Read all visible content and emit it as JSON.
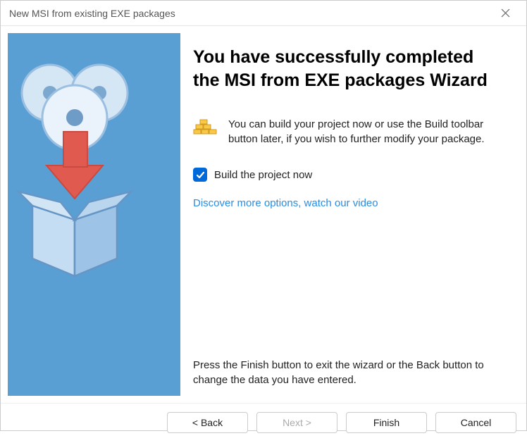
{
  "window": {
    "title": "New MSI from existing EXE packages"
  },
  "main": {
    "heading": "You have successfully completed the MSI from EXE packages Wizard",
    "info_text": "You can build your project now or use the Build toolbar button later, if you wish to further modify your package.",
    "checkbox_label": "Build the project now",
    "checkbox_checked": true,
    "link_text": "Discover more options, watch our video",
    "footer_hint": "Press the Finish button to exit the wizard or the Back button to change the data you have entered."
  },
  "buttons": {
    "back": "< Back",
    "next": "Next >",
    "finish": "Finish",
    "cancel": "Cancel"
  }
}
